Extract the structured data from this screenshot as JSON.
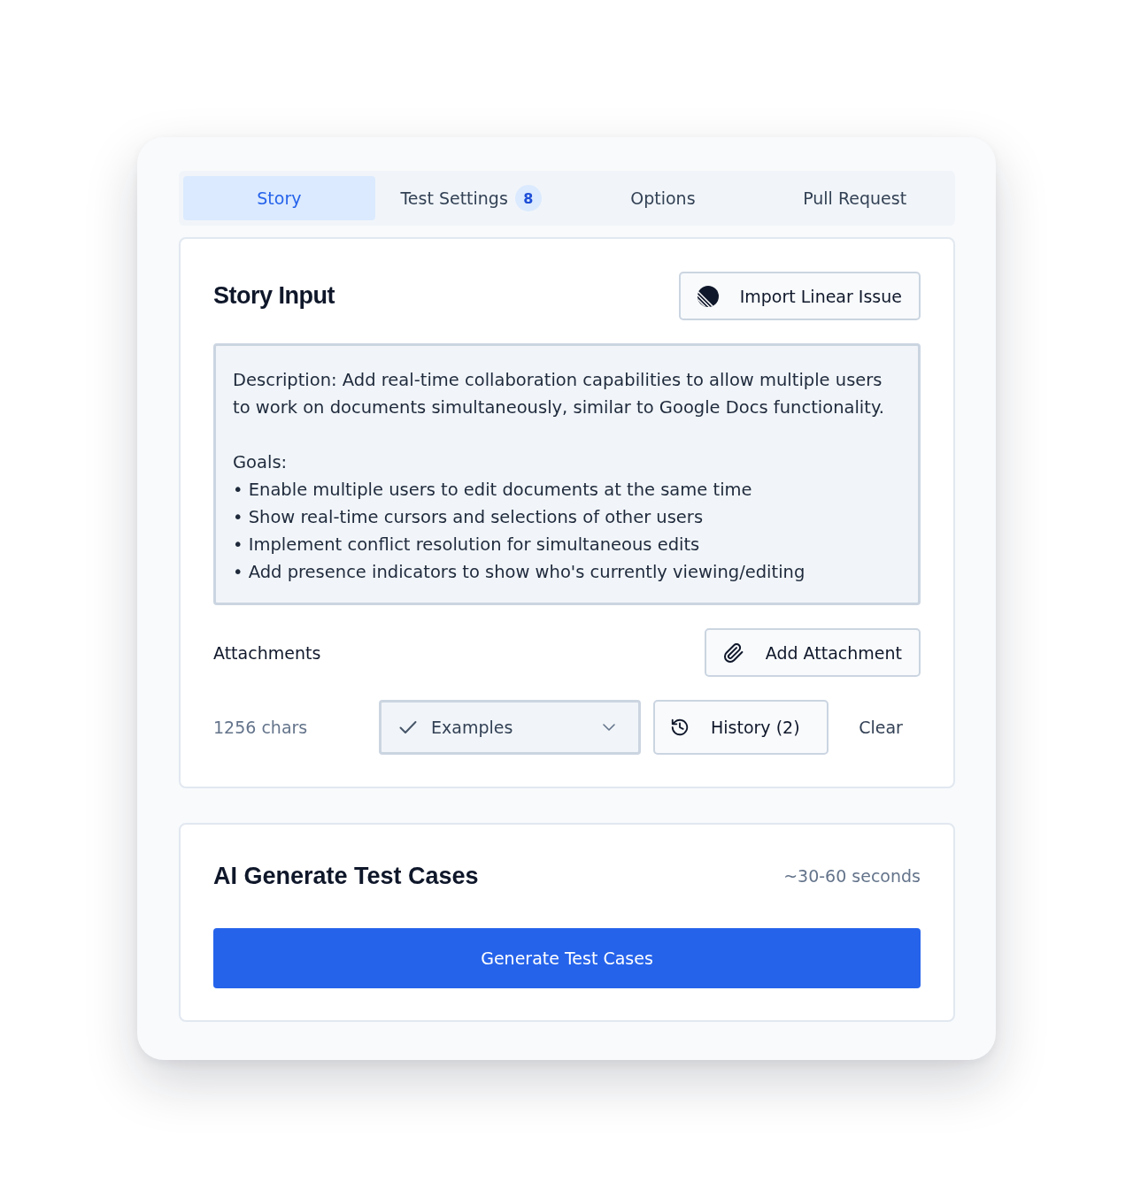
{
  "tabs": [
    {
      "label": "Story",
      "selected": true
    },
    {
      "label": "Test Settings",
      "selected": false,
      "badge": "8"
    },
    {
      "label": "Options",
      "selected": false
    },
    {
      "label": "Pull Request",
      "selected": false
    }
  ],
  "story_panel": {
    "title": "Story Input",
    "import_button": "Import Linear Issue",
    "story_field": {
      "value": "Description: Add real-time collaboration capabilities to allow multiple users to work on documents simultaneously, similar to Google Docs functionality.\n\nGoals:\n• Enable multiple users to edit documents at the same time\n• Show real-time cursors and selections of other users\n• Implement conflict resolution for simultaneous edits\n• Add presence indicators to show who's currently viewing/editing"
    },
    "attachments_label": "Attachments",
    "add_attachment_button": "Add Attachment",
    "char_count": "1256 chars",
    "examples_select": {
      "value": "Examples"
    },
    "history_button": "History (2)",
    "clear_button": "Clear"
  },
  "generate_panel": {
    "title": "AI Generate Test Cases",
    "estimate": "~30-60 seconds",
    "generate_button": "Generate Test Cases"
  }
}
